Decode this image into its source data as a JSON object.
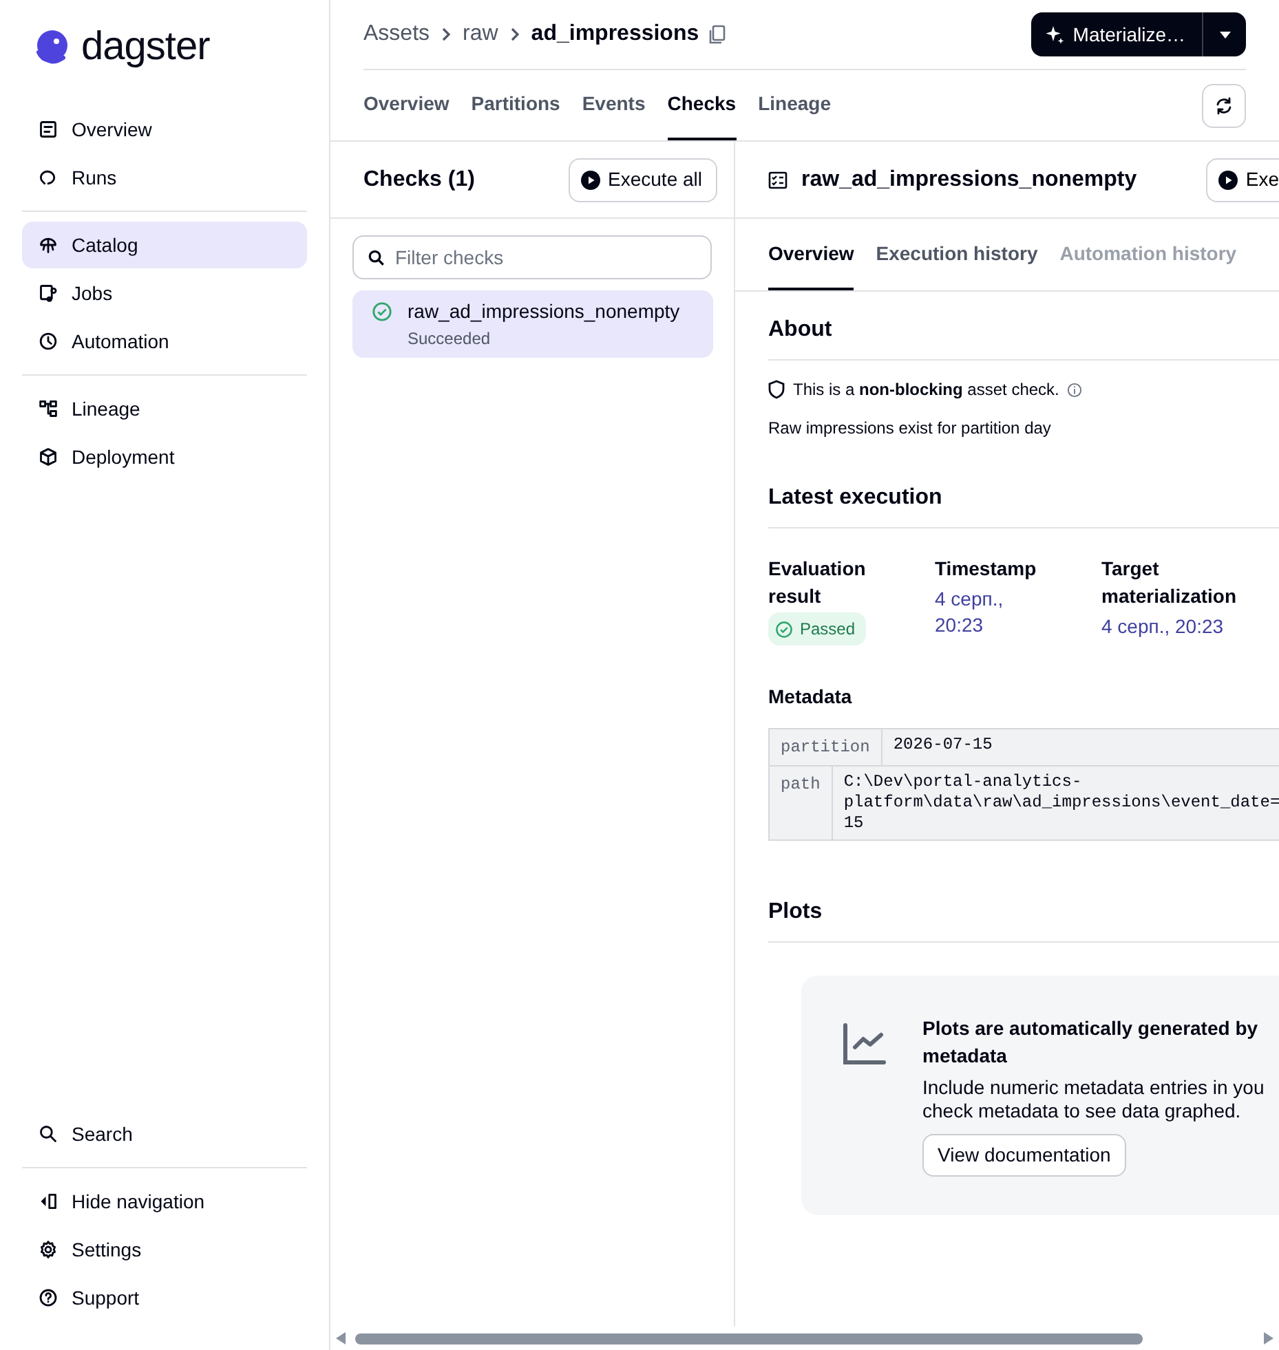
{
  "logo": {
    "text": "dagster"
  },
  "sidebar": {
    "groups": [
      [
        {
          "label": "Overview",
          "kind": "overview",
          "selected": false
        },
        {
          "label": "Runs",
          "kind": "runs",
          "selected": false
        }
      ],
      [
        {
          "label": "Catalog",
          "kind": "catalog",
          "selected": true
        },
        {
          "label": "Jobs",
          "kind": "jobs",
          "selected": false
        },
        {
          "label": "Automation",
          "kind": "clock",
          "selected": false
        }
      ],
      [
        {
          "label": "Lineage",
          "kind": "lineage",
          "selected": false
        },
        {
          "label": "Deployment",
          "kind": "cube",
          "selected": false
        }
      ]
    ],
    "bottom_groups": [
      [
        {
          "label": "Search",
          "kind": "search",
          "selected": false
        }
      ],
      [
        {
          "label": "Hide navigation",
          "kind": "hide",
          "selected": false
        },
        {
          "label": "Settings",
          "kind": "gear",
          "selected": false
        },
        {
          "label": "Support",
          "kind": "help",
          "selected": false
        }
      ]
    ]
  },
  "breadcrumb": [
    "Assets",
    "raw",
    "ad_impressions"
  ],
  "materialize_button": "Materialize…",
  "tabs": [
    {
      "label": "Overview",
      "selected": false
    },
    {
      "label": "Partitions",
      "selected": false
    },
    {
      "label": "Events",
      "selected": false
    },
    {
      "label": "Checks",
      "selected": true
    },
    {
      "label": "Lineage",
      "selected": false
    }
  ],
  "checks_panel": {
    "title": "Checks (1)",
    "execute_all": "Execute all",
    "search": {
      "placeholder": "Filter checks"
    },
    "items": [
      {
        "name": "raw_ad_impressions_nonempty",
        "status": "Succeeded",
        "selected": true
      }
    ]
  },
  "detail": {
    "title": "raw_ad_impressions_nonempty",
    "execute_button": "Exe",
    "subtabs": [
      {
        "label": "Overview",
        "selected": true,
        "disabled": false
      },
      {
        "label": "Execution history",
        "selected": false,
        "disabled": false
      },
      {
        "label": "Automation history",
        "selected": false,
        "disabled": true
      }
    ],
    "about": {
      "heading": "About",
      "notice": "This is a **non-blocking** asset check.",
      "description": "Raw impressions exist for partition day"
    },
    "latest": {
      "heading": "Latest execution",
      "columns": [
        {
          "label": "Evaluation result",
          "kind": "badge",
          "value": "Passed"
        },
        {
          "label": "Timestamp",
          "kind": "link",
          "value": "4 серп., 20:23"
        },
        {
          "label": "Target materialization",
          "kind": "link",
          "value": "4 серп., 20:23"
        }
      ]
    },
    "metadata": {
      "heading": "Metadata",
      "rows": [
        {
          "key": "partition",
          "lines": [
            "2026-07-15"
          ]
        },
        {
          "key": "path",
          "lines": [
            "C:\\Dev\\portal-analytics-",
            "platform\\data\\raw\\ad_impressions\\event_date=",
            "15"
          ]
        }
      ]
    },
    "plots": {
      "heading": "Plots",
      "title": "Plots are automatically generated by metadata",
      "body": [
        "Include numeric metadata entries in you",
        "check metadata to see data graphed."
      ],
      "button": "View documentation"
    }
  }
}
